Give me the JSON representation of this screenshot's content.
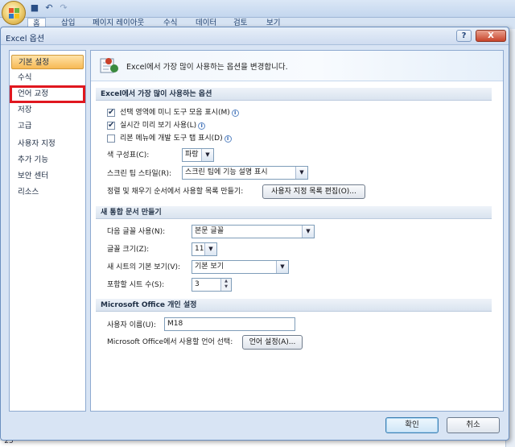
{
  "excel": {
    "tabs": [
      "홈",
      "삽입",
      "페이지 레이아웃",
      "수식",
      "데이터",
      "검토",
      "보기"
    ],
    "row_number": "25"
  },
  "dialog": {
    "title": "Excel 옵션",
    "help_label": "?",
    "close_label": "X"
  },
  "nav": {
    "items": [
      {
        "label": "기본 설정"
      },
      {
        "label": "수식"
      },
      {
        "label": "언어 교정"
      },
      {
        "label": "저장"
      },
      {
        "label": "고급"
      },
      {
        "label": "사용자 지정"
      },
      {
        "label": "추가 기능"
      },
      {
        "label": "보안 센터"
      },
      {
        "label": "리소스"
      }
    ],
    "selected_index": 0,
    "highlighted_index": 2
  },
  "content": {
    "header": "Excel에서 가장 많이 사용하는 옵션을 변경합니다.",
    "section1": {
      "title": "Excel에서 가장 많이 사용하는 옵션",
      "checkboxes": [
        {
          "label": "선택 영역에 미니 도구 모음 표시(M)",
          "checked": true
        },
        {
          "label": "실시간 미리 보기 사용(L)",
          "checked": true
        },
        {
          "label": "리본 메뉴에 개발 도구 탭 표시(D)",
          "checked": false
        }
      ],
      "color_scheme_label": "색 구성표(C):",
      "color_scheme_value": "파랑",
      "screentip_label": "스크린 팁 스타일(R):",
      "screentip_value": "스크린 팁에 기능 설명 표시",
      "sort_list_label": "정렬 및 채우기 순서에서 사용할 목록 만들기:",
      "sort_list_button": "사용자 지정 목록 편집(O)..."
    },
    "section2": {
      "title": "새 통합 문서 만들기",
      "font_label": "다음 글꼴 사용(N):",
      "font_value": "본문 글꼴",
      "font_size_label": "글꼴 크기(Z):",
      "font_size_value": "11",
      "default_view_label": "새 시트의 기본 보기(V):",
      "default_view_value": "기본 보기",
      "sheet_count_label": "포함할 시트 수(S):",
      "sheet_count_value": "3"
    },
    "section3": {
      "title": "Microsoft Office 개인 설정",
      "username_label": "사용자 이름(U):",
      "username_value": "M18",
      "language_label": "Microsoft Office에서 사용할 언어 선택:",
      "language_button": "언어 설정(A)..."
    }
  },
  "footer": {
    "ok_label": "확인",
    "cancel_label": "취소"
  }
}
